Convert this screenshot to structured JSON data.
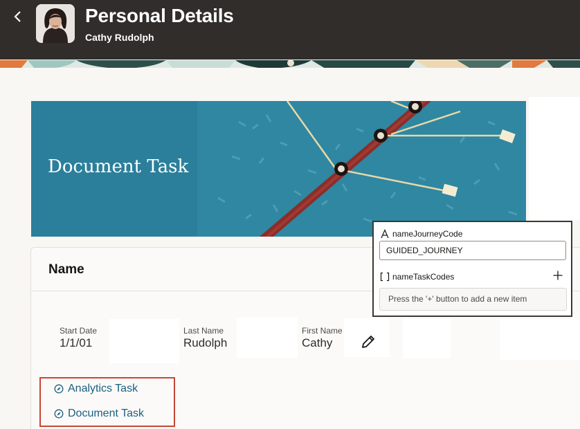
{
  "header": {
    "title": "Personal Details",
    "subtitle": "Cathy Rudolph"
  },
  "banner": {
    "title": "Document Task"
  },
  "name_section": {
    "title": "Name",
    "fields": {
      "start_date": {
        "label": "Start Date",
        "value": "1/1/01"
      },
      "last_name": {
        "label": "Last Name",
        "value": "Rudolph"
      },
      "first_name": {
        "label": "First Name",
        "value": "Cathy"
      }
    }
  },
  "tasks": [
    {
      "label": "Analytics Task"
    },
    {
      "label": "Document Task"
    }
  ],
  "property_popup": {
    "journey_code_label": "nameJourneyCode",
    "journey_code_value": "GUIDED_JOURNEY",
    "task_codes_label": "nameTaskCodes",
    "empty_message": "Press the '+' button to add a new item"
  },
  "icons": {
    "back": "chevron-left-icon",
    "edit": "pencil-icon",
    "task": "compass-icon",
    "text_type": "text-a-icon",
    "array_type": "brackets-icon",
    "add": "plus-icon"
  },
  "colors": {
    "header_bg": "#312d2a",
    "banner_bg": "#2b7f9b",
    "link": "#1b5e80",
    "highlight_border": "#c74634"
  }
}
